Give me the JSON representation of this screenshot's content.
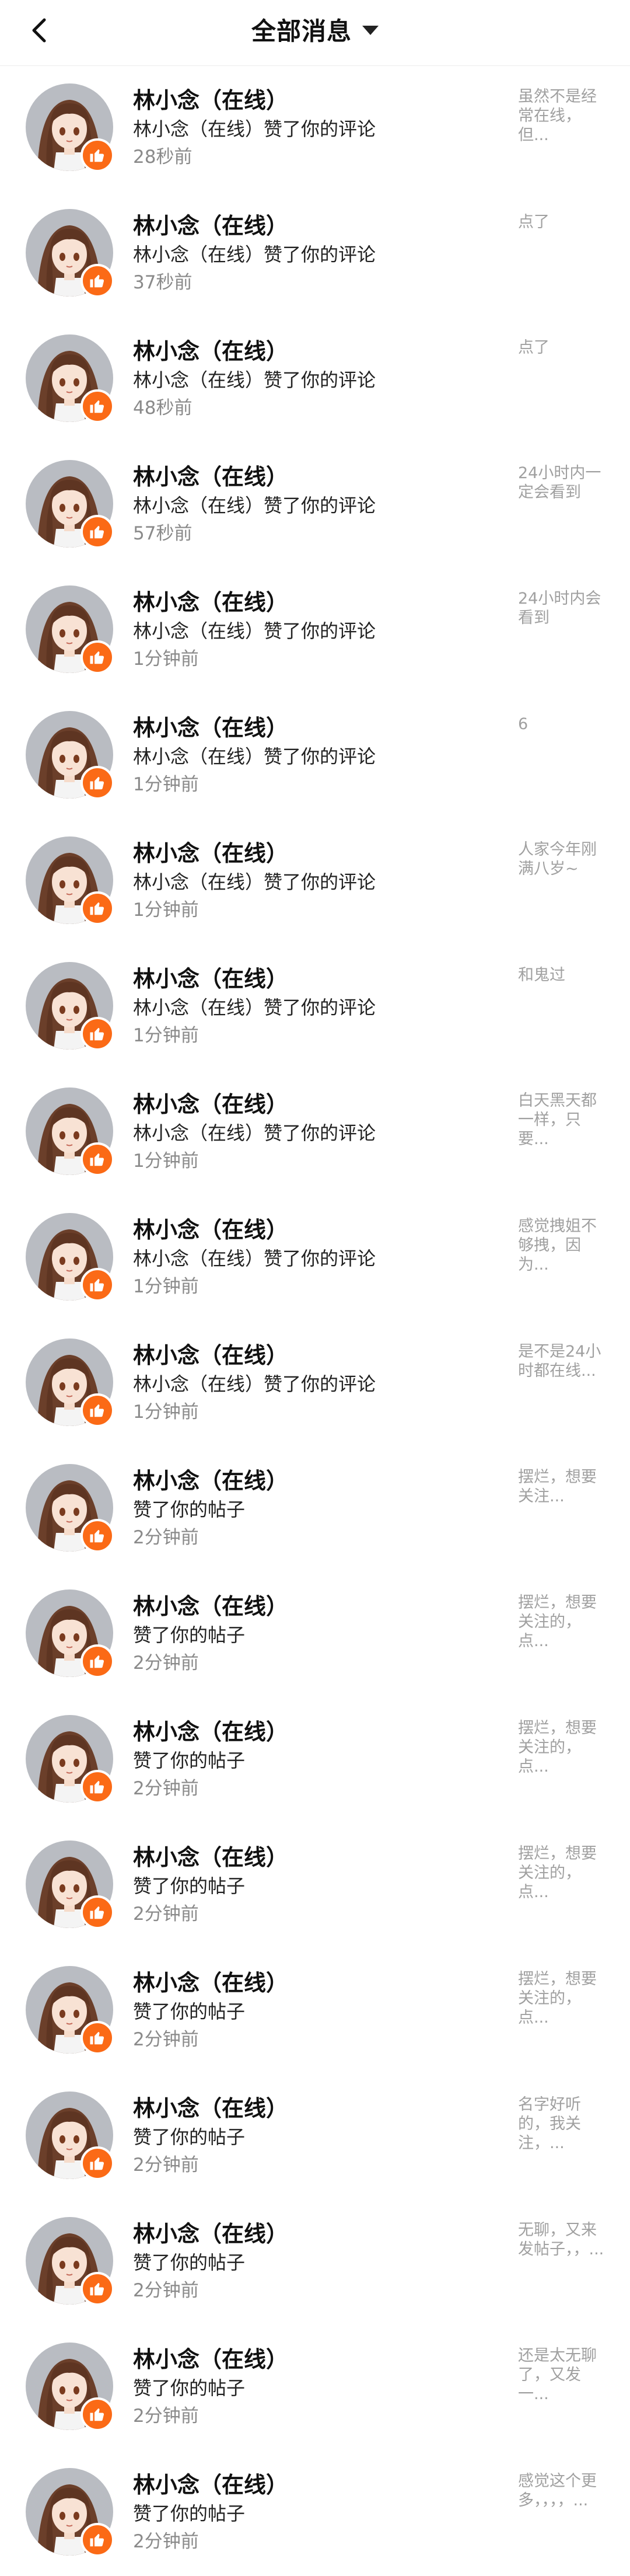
{
  "header": {
    "title": "全部消息"
  },
  "notifications": [
    {
      "name": "林小念（在线）",
      "action": "林小念（在线）赞了你的评论",
      "time": "28秒前",
      "snippet": "虽然不是经常在线，但..."
    },
    {
      "name": "林小念（在线）",
      "action": "林小念（在线）赞了你的评论",
      "time": "37秒前",
      "snippet": "点了"
    },
    {
      "name": "林小念（在线）",
      "action": "林小念（在线）赞了你的评论",
      "time": "48秒前",
      "snippet": "点了"
    },
    {
      "name": "林小念（在线）",
      "action": "林小念（在线）赞了你的评论",
      "time": "57秒前",
      "snippet": "24小时内一定会看到"
    },
    {
      "name": "林小念（在线）",
      "action": "林小念（在线）赞了你的评论",
      "time": "1分钟前",
      "snippet": "24小时内会看到"
    },
    {
      "name": "林小念（在线）",
      "action": "林小念（在线）赞了你的评论",
      "time": "1分钟前",
      "snippet": "6"
    },
    {
      "name": "林小念（在线）",
      "action": "林小念（在线）赞了你的评论",
      "time": "1分钟前",
      "snippet": "人家今年刚满八岁~"
    },
    {
      "name": "林小念（在线）",
      "action": "林小念（在线）赞了你的评论",
      "time": "1分钟前",
      "snippet": "和鬼过"
    },
    {
      "name": "林小念（在线）",
      "action": "林小念（在线）赞了你的评论",
      "time": "1分钟前",
      "snippet": "白天黑天都一样，只要..."
    },
    {
      "name": "林小念（在线）",
      "action": "林小念（在线）赞了你的评论",
      "time": "1分钟前",
      "snippet": "感觉拽姐不够拽，因为..."
    },
    {
      "name": "林小念（在线）",
      "action": "林小念（在线）赞了你的评论",
      "time": "1分钟前",
      "snippet": "是不是24小时都在线..."
    },
    {
      "name": "林小念（在线）",
      "action": "赞了你的帖子",
      "time": "2分钟前",
      "snippet": "摆烂，想要关注..."
    },
    {
      "name": "林小念（在线）",
      "action": "赞了你的帖子",
      "time": "2分钟前",
      "snippet": "摆烂，想要关注的，点..."
    },
    {
      "name": "林小念（在线）",
      "action": "赞了你的帖子",
      "time": "2分钟前",
      "snippet": "摆烂，想要关注的，点..."
    },
    {
      "name": "林小念（在线）",
      "action": "赞了你的帖子",
      "time": "2分钟前",
      "snippet": "摆烂，想要关注的，点..."
    },
    {
      "name": "林小念（在线）",
      "action": "赞了你的帖子",
      "time": "2分钟前",
      "snippet": "摆烂，想要关注的，点..."
    },
    {
      "name": "林小念（在线）",
      "action": "赞了你的帖子",
      "time": "2分钟前",
      "snippet": "名字好听的，我关注，..."
    },
    {
      "name": "林小念（在线）",
      "action": "赞了你的帖子",
      "time": "2分钟前",
      "snippet": "无聊，又来发帖子，，..."
    },
    {
      "name": "林小念（在线）",
      "action": "赞了你的帖子",
      "time": "2分钟前",
      "snippet": "还是太无聊了，又发一..."
    },
    {
      "name": "林小念（在线）",
      "action": "赞了你的帖子",
      "time": "2分钟前",
      "snippet": "感觉这个更多，，，，..."
    }
  ]
}
